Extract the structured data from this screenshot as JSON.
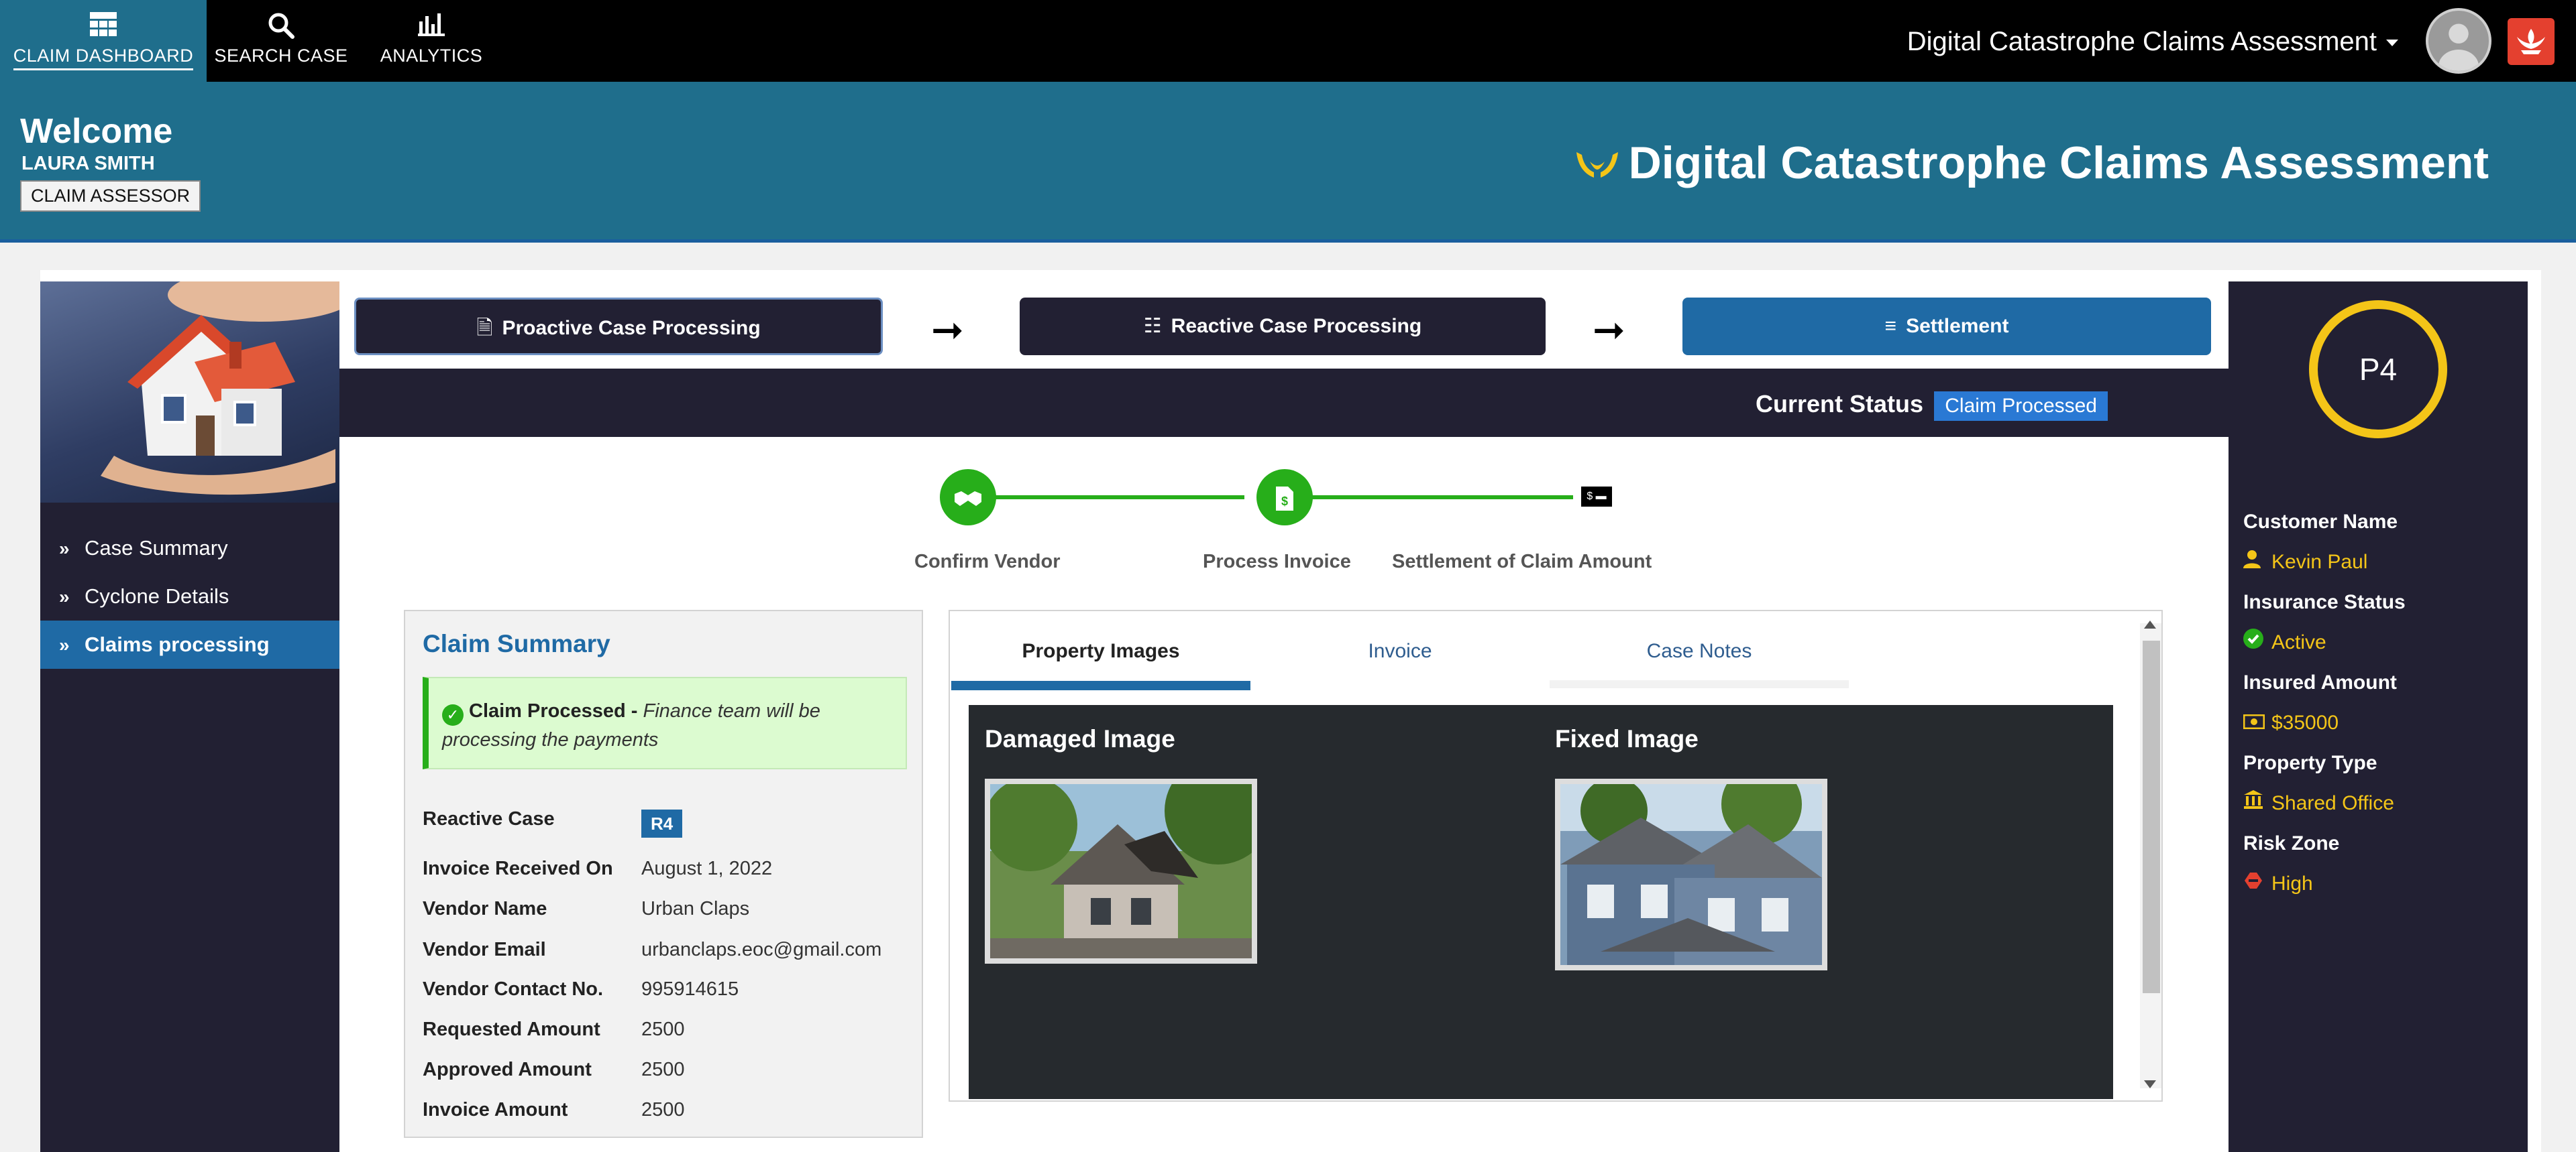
{
  "nav": {
    "items": [
      {
        "label": "CLAIM DASHBOARD",
        "icon": "dashboard-grid-icon",
        "active": true
      },
      {
        "label": "SEARCH CASE",
        "icon": "search-icon",
        "active": false
      },
      {
        "label": "ANALYTICS",
        "icon": "bar-chart-icon",
        "active": false
      }
    ],
    "app_title": "Digital Catastrophe Claims Assessment"
  },
  "banner": {
    "welcome": "Welcome",
    "user_name": "LAURA SMITH",
    "role": "CLAIM ASSESSOR",
    "title": "Digital Catastrophe Claims Assessment"
  },
  "sidebar": {
    "items": [
      {
        "label": "Case Summary",
        "active": false
      },
      {
        "label": "Cyclone Details",
        "active": false
      },
      {
        "label": "Claims processing",
        "active": true
      }
    ]
  },
  "steps": {
    "buttons": [
      {
        "label": "Proactive Case Processing",
        "icon": "document-icon",
        "color": "#222033"
      },
      {
        "label": "Reactive Case Processing",
        "icon": "checklist-icon",
        "color": "#222033"
      },
      {
        "label": "Settlement",
        "icon": "list-icon",
        "color": "#1f6aa5"
      }
    ],
    "arrow": "➞"
  },
  "status": {
    "label": "Current Status",
    "value": "Claim Processed"
  },
  "tracker": {
    "steps": [
      {
        "label": "Confirm Vendor",
        "icon": "handshake-icon",
        "done": true
      },
      {
        "label": "Process Invoice",
        "icon": "invoice-icon",
        "done": true
      },
      {
        "label": "Settlement of Claim Amount",
        "icon": "cheque-icon",
        "done": false
      }
    ]
  },
  "summary": {
    "title": "Claim Summary",
    "alert_bold": "Claim Processed - ",
    "alert_italic": "Finance team will be processing the payments",
    "rows": [
      {
        "key": "Reactive Case",
        "value": "R4"
      },
      {
        "key": "Invoice Received On",
        "value": "August 1, 2022"
      },
      {
        "key": "Vendor Name",
        "value": "Urban Claps"
      },
      {
        "key": "Vendor Email",
        "value": "urbanclaps.eoc@gmail.com"
      },
      {
        "key": "Vendor Contact No.",
        "value": "995914615"
      },
      {
        "key": "Requested Amount",
        "value": "2500"
      },
      {
        "key": "Approved Amount",
        "value": "2500"
      },
      {
        "key": "Invoice Amount",
        "value": "2500"
      }
    ]
  },
  "tabs": {
    "items": [
      {
        "label": "Property Images",
        "active": true
      },
      {
        "label": "Invoice",
        "active": false
      },
      {
        "label": "Case Notes",
        "active": false
      }
    ],
    "damaged_title": "Damaged Image",
    "fixed_title": "Fixed Image"
  },
  "customer": {
    "priority": "P4",
    "fields": [
      {
        "label": "Customer Name",
        "value": "Kevin Paul",
        "icon": "user-icon"
      },
      {
        "label": "Insurance Status",
        "value": "Active",
        "icon": "check-circle-icon"
      },
      {
        "label": "Insured Amount",
        "value": "$35000",
        "icon": "money-icon"
      },
      {
        "label": "Property Type",
        "value": "Shared Office",
        "icon": "building-icon"
      },
      {
        "label": "Risk Zone",
        "value": "High",
        "icon": "alert-icon"
      }
    ]
  },
  "colors": {
    "nav_bg": "#000000",
    "banner_bg": "#1f6e8c",
    "panel_dark": "#222033",
    "accent_blue": "#1f6aa5",
    "accent_yellow": "#f4c518",
    "success_green": "#27ae1a",
    "danger_red": "#e4402f"
  }
}
